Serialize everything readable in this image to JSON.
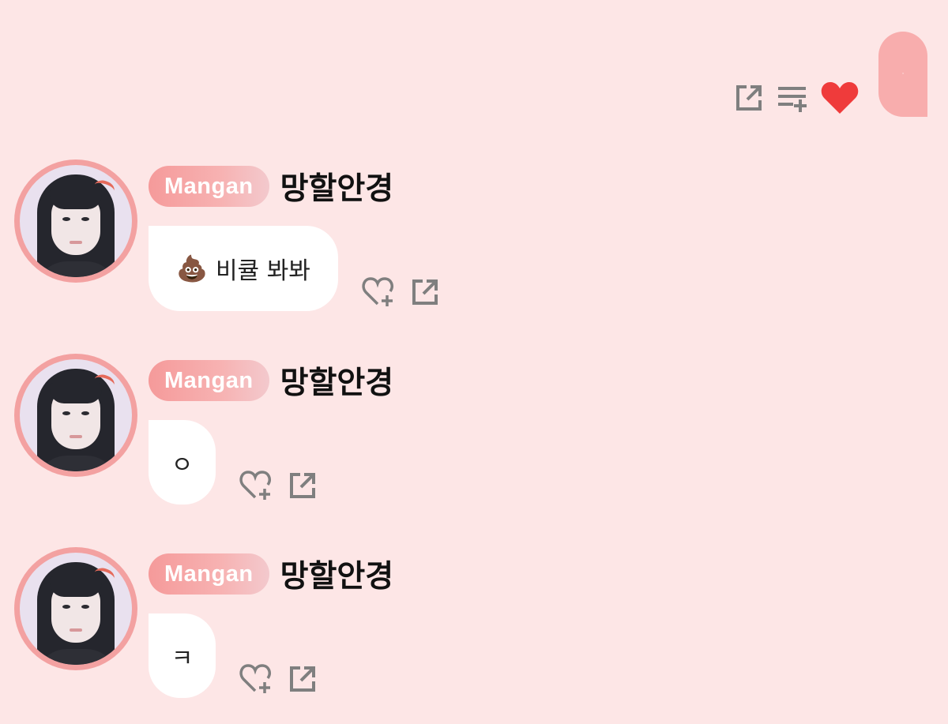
{
  "my_message": {
    "text": "·",
    "actions": [
      {
        "icon": "share-icon"
      },
      {
        "icon": "add-to-playlist-icon"
      },
      {
        "icon": "heart-filled-icon",
        "color": "#ef3b3b"
      }
    ]
  },
  "colors": {
    "background": "#fde6e6",
    "my_bubble": "#f8adad",
    "badge": "#f59a9a",
    "avatar_ring": "#f3a1a1"
  },
  "messages": [
    {
      "badge": "Mangan",
      "username": "망할안경",
      "emoji": "💩",
      "text": "비큘 봐봐"
    },
    {
      "badge": "Mangan",
      "username": "망할안경",
      "emoji": "",
      "text": "ㅇ"
    },
    {
      "badge": "Mangan",
      "username": "망할안경",
      "emoji": "",
      "text": "ㅋ"
    }
  ],
  "message_actions": [
    {
      "icon": "heart-add-icon"
    },
    {
      "icon": "share-icon"
    }
  ]
}
